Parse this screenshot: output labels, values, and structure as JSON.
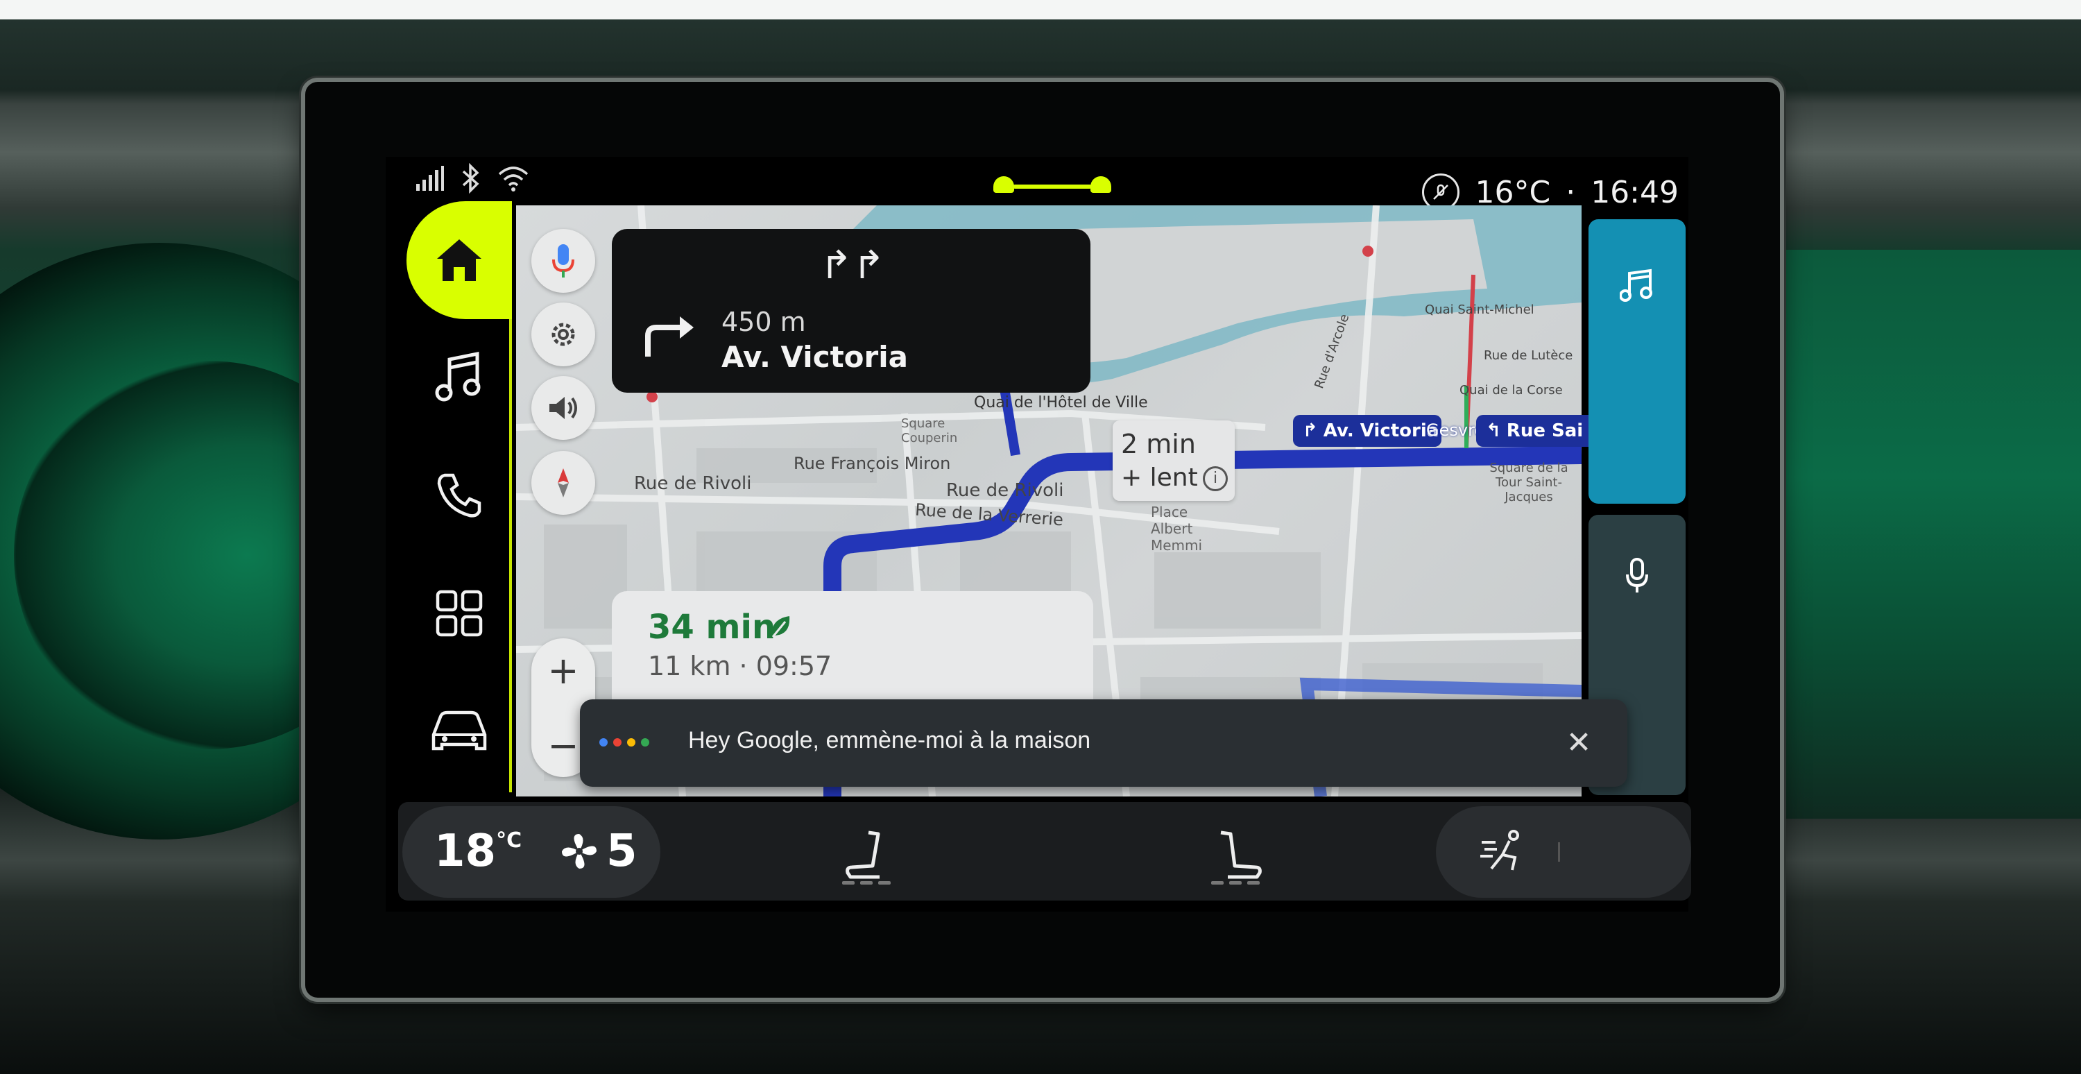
{
  "status_bar": {
    "temperature": "16°C",
    "separator": "·",
    "time": "16:49"
  },
  "navigation": {
    "distance": "450 m",
    "street": "Av. Victoria",
    "lanes_glyph": "↱↱"
  },
  "eta": {
    "duration": "34 min",
    "details": "11 km · 09:57"
  },
  "traffic": {
    "delay": "2 min",
    "label": "+ lent",
    "info_glyph": "i"
  },
  "route_chips": {
    "turn_right": "Av. Victoria",
    "turn_left": "Rue Sai"
  },
  "map_labels": {
    "rivoli_1": "Rue de Rivoli",
    "francois_miron": "Rue François Miron",
    "rivoli_2": "Rue de Rivoli",
    "verrerie": "Rue de la Verrerie",
    "hotel_de_ville": "Quai de l'Hôtel de Ville",
    "quai_st_michel": "Quai Saint-Michel",
    "rue_lutece": "Rue de Lutèce",
    "quai_corse": "Quai de la Corse",
    "rue_arcole": "Rue d'Arcole",
    "square_couperin": "Square Couperin",
    "place_albert": "Place Albert Memmi",
    "square_tour": "Square de la Tour Saint-Jacques",
    "gesvres": "Gesvres"
  },
  "map_controls": {
    "zoom_in": "+",
    "zoom_out": "−"
  },
  "assistant": {
    "text": "Hey Google, emmène-moi à la maison",
    "close_glyph": "✕"
  },
  "climate": {
    "temperature": "18",
    "temperature_unit": "°C",
    "fan_level": "5"
  },
  "colors": {
    "accent": "#d9ff00",
    "music_tile": "#1490b3",
    "route": "#1c2f9a",
    "eta_green": "#1e7a3a"
  },
  "icons": {
    "signal": "signal-icon",
    "bluetooth": "bluetooth-icon",
    "wifi": "wifi-icon",
    "mute": "mute-icon",
    "home": "home-icon",
    "music": "music-note-icon",
    "phone": "phone-icon",
    "apps": "apps-grid-icon",
    "car": "car-icon",
    "mic": "mic-icon",
    "settings": "gear-icon",
    "volume": "volume-icon",
    "compass": "compass-icon",
    "fan": "fan-icon",
    "seat": "seat-heat-icon",
    "air": "air-recirculation-icon"
  }
}
